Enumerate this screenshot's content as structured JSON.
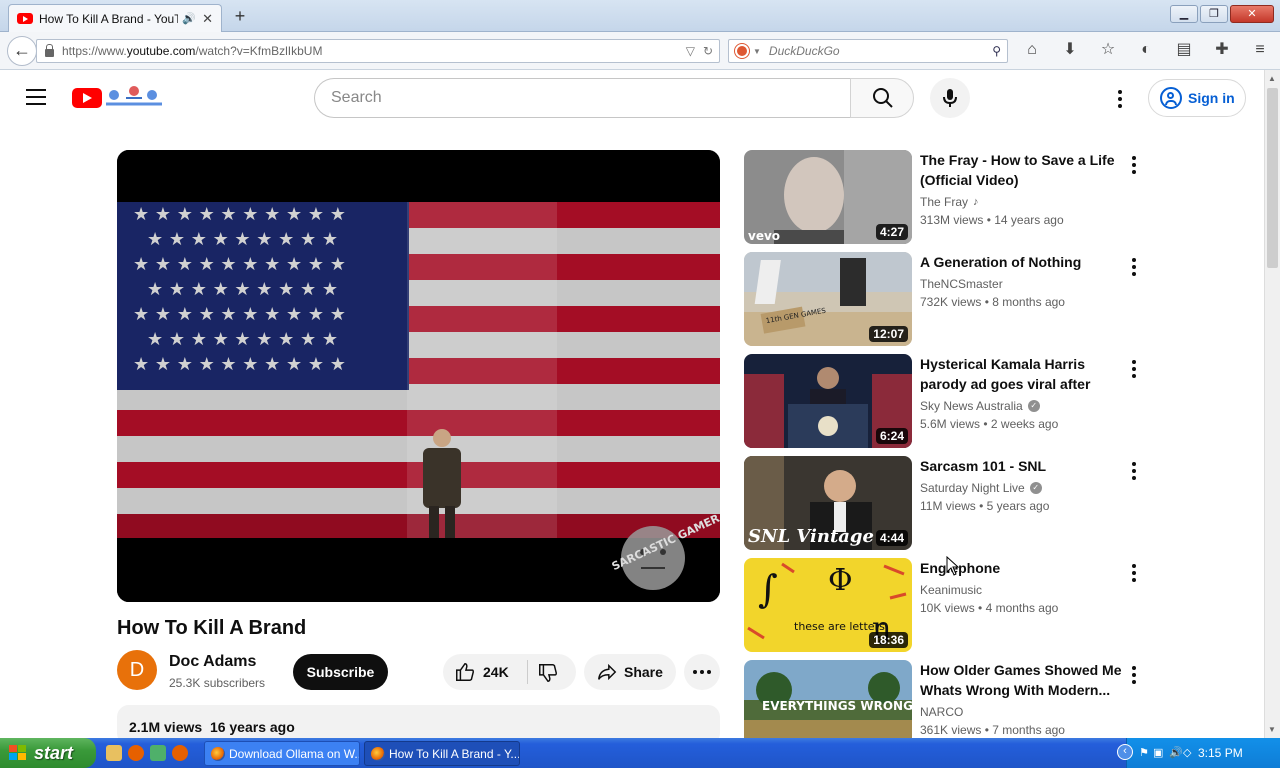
{
  "browser": {
    "tab_title": "How To Kill A Brand - YouT...",
    "url_prefix": "https://www.",
    "url_domain": "youtube.com",
    "url_path": "/watch?v=KfmBzlIkbUM",
    "search_placeholder": "DuckDuckGo"
  },
  "header": {
    "search_placeholder": "Search",
    "sign_in": "Sign in"
  },
  "video": {
    "title": "How To Kill A Brand",
    "watermark": "SARCASTIC GAMER",
    "channel": "Doc Adams",
    "channel_initial": "D",
    "subscribers": "25.3K subscribers",
    "subscribe": "Subscribe",
    "likes": "24K",
    "share": "Share",
    "views": "2.1M views",
    "age": "16 years ago"
  },
  "recommendations": [
    {
      "title": "The Fray - How to Save a Life (Official Video)",
      "channel": "The Fray",
      "channel_badge": "music",
      "views": "313M views",
      "age": "14 years ago",
      "duration": "4:27",
      "thumb_text": "vevo"
    },
    {
      "title": "A Generation of Nothing",
      "channel": "TheNCSmaster",
      "channel_badge": "",
      "views": "732K views",
      "age": "8 months ago",
      "duration": "12:07",
      "thumb_text": "11th GEN GAMES"
    },
    {
      "title": "Hysterical Kamala Harris parody ad goes viral after being bann...",
      "channel": "Sky News Australia",
      "channel_badge": "verified",
      "views": "5.6M views",
      "age": "2 weeks ago",
      "duration": "6:24",
      "thumb_text": ""
    },
    {
      "title": "Sarcasm 101 - SNL",
      "channel": "Saturday Night Live",
      "channel_badge": "verified",
      "views": "11M views",
      "age": "5 years ago",
      "duration": "4:44",
      "thumb_text": "SNL Vintage"
    },
    {
      "title": "Englephone",
      "channel": "Keanimusic",
      "channel_badge": "",
      "views": "10K views",
      "age": "4 months ago",
      "duration": "18:36",
      "thumb_text": "these are letters"
    },
    {
      "title": "How Older Games Showed Me Whats Wrong With Modern...",
      "channel": "NARCO",
      "channel_badge": "",
      "views": "361K views",
      "age": "7 months ago",
      "duration": "",
      "thumb_text": "EVERYTHINGS WRONG"
    }
  ],
  "taskbar": {
    "start": "start",
    "items": [
      "Download Ollama on W...",
      "How To Kill A Brand - Y..."
    ],
    "clock": "3:15 PM"
  },
  "colors": {
    "youtube_red": "#ff0000",
    "link_blue": "#065fd4",
    "xp_taskbar": "#245edb",
    "xp_start": "#3a9a3a"
  }
}
